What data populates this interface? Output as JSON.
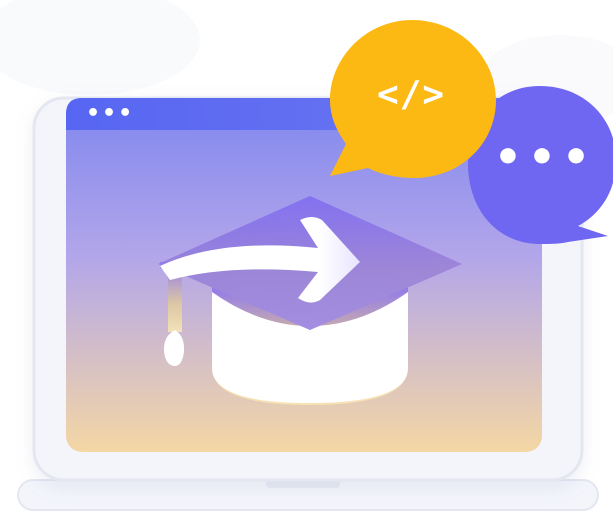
{
  "illustration": {
    "code_badge_text": "</>",
    "chat_badge_text": "•••",
    "window_control_dots": "•••"
  },
  "icons": {
    "laptop": "laptop-icon",
    "graduation_cap": "graduation-cap-icon",
    "arrow": "arrow-right-icon",
    "code_bubble": "code-bubble-icon",
    "chat_bubble": "chat-bubble-icon"
  },
  "colors": {
    "accent_purple": "#6E63F0",
    "accent_yellow": "#FDB913",
    "screen_top": "#7E82EE",
    "screen_bottom": "#F4D7A6",
    "laptop_body": "#F1F3FA",
    "laptop_stroke": "#E3E6F0"
  }
}
